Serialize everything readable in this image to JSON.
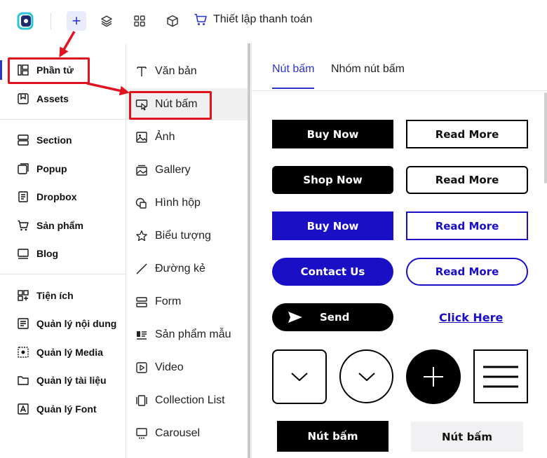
{
  "topbar": {
    "add_icon": "plus-icon",
    "checkout_label": "Thiết lập thanh toán"
  },
  "sidebar": {
    "items": [
      {
        "label": "Phần tử",
        "icon": "elements-icon"
      },
      {
        "label": "Assets",
        "icon": "assets-icon"
      },
      {
        "label": "Section",
        "icon": "section-icon"
      },
      {
        "label": "Popup",
        "icon": "popup-icon"
      },
      {
        "label": "Dropbox",
        "icon": "dropbox-icon"
      },
      {
        "label": "Sản phẩm",
        "icon": "cart-icon"
      },
      {
        "label": "Blog",
        "icon": "blog-icon"
      },
      {
        "label": "Tiện ích",
        "icon": "widgets-icon"
      },
      {
        "label": "Quản lý nội dung",
        "icon": "content-icon"
      },
      {
        "label": "Quản lý Media",
        "icon": "media-icon"
      },
      {
        "label": "Quản lý tài liệu",
        "icon": "folder-icon"
      },
      {
        "label": "Quản lý Font",
        "icon": "font-icon"
      }
    ]
  },
  "elements": {
    "items": [
      {
        "label": "Văn bản",
        "icon": "text-icon"
      },
      {
        "label": "Nút bấm",
        "icon": "button-icon"
      },
      {
        "label": "Ảnh",
        "icon": "image-icon"
      },
      {
        "label": "Gallery",
        "icon": "gallery-icon"
      },
      {
        "label": "Hình hộp",
        "icon": "shape-icon"
      },
      {
        "label": "Biểu tượng",
        "icon": "star-icon"
      },
      {
        "label": "Đường kẻ",
        "icon": "line-icon"
      },
      {
        "label": "Form",
        "icon": "form-icon"
      },
      {
        "label": "Sản phẩm mẫu",
        "icon": "product-sample-icon"
      },
      {
        "label": "Video",
        "icon": "video-icon"
      },
      {
        "label": "Collection List",
        "icon": "collection-icon"
      },
      {
        "label": "Carousel",
        "icon": "carousel-icon"
      }
    ]
  },
  "tabs": [
    {
      "label": "Nút bấm",
      "active": true
    },
    {
      "label": "Nhóm nút bấm",
      "active": false
    }
  ],
  "buttons": {
    "buy_now_1": "Buy Now",
    "read_more_1": "Read More",
    "shop_now": "Shop Now",
    "read_more_2": "Read More",
    "buy_now_2": "Buy Now",
    "read_more_3": "Read More",
    "contact_us": "Contact Us",
    "read_more_4": "Read More",
    "send": "Send",
    "click_here": "Click Here",
    "nut_bam_1": "Nút bấm",
    "nut_bam_2": "Nút bấm"
  },
  "colors": {
    "accent": "#2b35c9",
    "button_blue": "#1a0fc4",
    "annotation_red": "#e0141e"
  }
}
